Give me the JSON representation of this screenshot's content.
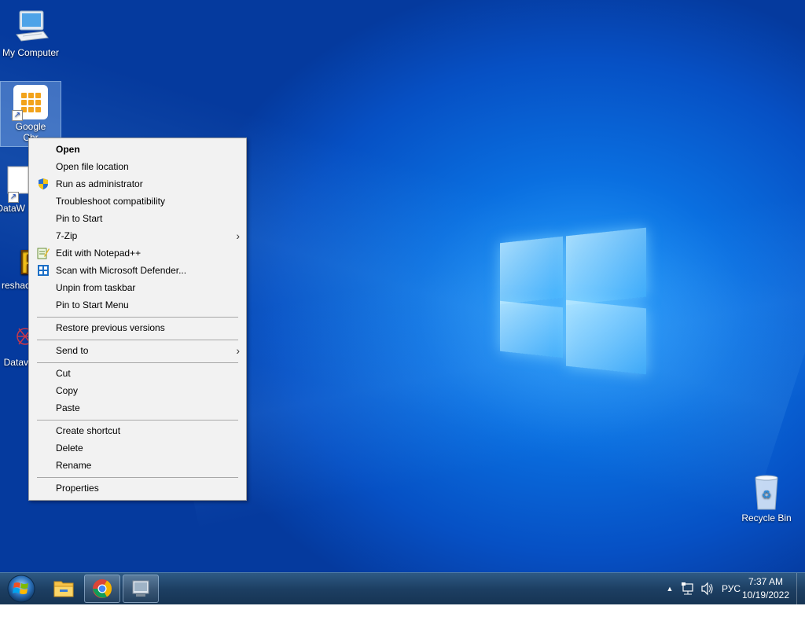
{
  "desktop": {
    "icons": [
      {
        "label": "My Computer",
        "icon": "computer-icon"
      },
      {
        "label": "Google\nChr",
        "icon": "google-apps-icon"
      },
      {
        "label": "DataW",
        "icon": "document-icon"
      },
      {
        "label": "reshac",
        "icon": "resource-hacker-icon"
      },
      {
        "label": "Datav",
        "icon": "network-icon"
      },
      {
        "label": "Recycle Bin",
        "icon": "recycle-bin-icon"
      }
    ]
  },
  "context_menu": {
    "items": [
      {
        "label": "Open",
        "bold": true
      },
      {
        "label": "Open file location"
      },
      {
        "label": "Run as administrator",
        "icon": "uac-shield-icon"
      },
      {
        "label": "Troubleshoot compatibility"
      },
      {
        "label": "Pin to Start"
      },
      {
        "label": "7-Zip",
        "submenu": true
      },
      {
        "label": "Edit with Notepad++",
        "icon": "notepad-plus-plus-icon"
      },
      {
        "label": "Scan with Microsoft Defender...",
        "icon": "defender-icon"
      },
      {
        "label": "Unpin from taskbar"
      },
      {
        "label": "Pin to Start Menu"
      },
      {
        "label": "Restore previous versions"
      },
      {
        "label": "Send to",
        "submenu": true
      },
      {
        "label": "Cut"
      },
      {
        "label": "Copy"
      },
      {
        "label": "Paste"
      },
      {
        "label": "Create shortcut"
      },
      {
        "label": "Delete"
      },
      {
        "label": "Rename"
      },
      {
        "label": "Properties"
      }
    ],
    "submenu_arrow": ">"
  },
  "taskbar": {
    "start_icon": "windows-start-orb-icon",
    "pinned": [
      "file-explorer-icon",
      "chrome-icon",
      "app-icon"
    ],
    "tray": {
      "show_hidden_arrow": "▲",
      "network_icon": "network-icon",
      "volume_icon": "speaker-icon",
      "language": "РУС"
    },
    "clock": {
      "time": "7:37 AM",
      "date": "10/19/2022"
    }
  },
  "colors": {
    "accent": "#0a6fe0",
    "taskbar": "#1d3f63",
    "menu_bg": "#f2f2f2"
  }
}
